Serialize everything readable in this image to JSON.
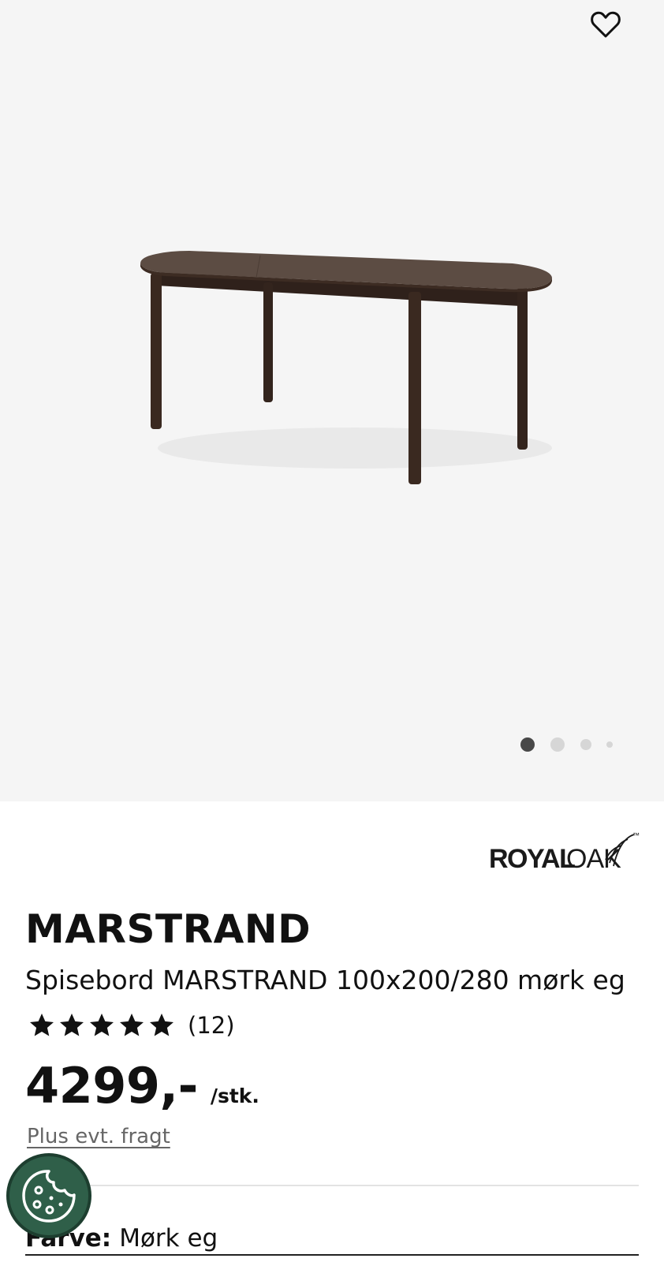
{
  "gallery": {
    "favorite_icon": "heart-outline-icon",
    "image_alt": "Spisebord MARSTRAND 100x200/280 mørk eg",
    "slides_count": 4,
    "active_slide": 1
  },
  "brand": {
    "name_bold": "ROYAL",
    "name_light": "OAK",
    "trademark": "™"
  },
  "product": {
    "name": "MARSTRAND",
    "description": "Spisebord MARSTRAND 100x200/280 mørk eg",
    "rating_stars": 5,
    "review_count": "(12)",
    "price": "4299,-",
    "unit": "/stk.",
    "freight_link": "Plus evt. fragt"
  },
  "options": {
    "color_label": "Farve:",
    "color_value": "Mørk eg"
  },
  "cookie": {
    "icon": "cookie-icon"
  },
  "colors": {
    "gallery_bg": "#f5f5f5",
    "cookie_button": "#2f5f49",
    "active_dot": "#484848",
    "inactive_dot": "#d6d6d6",
    "table_wood": "#3b2a22"
  }
}
